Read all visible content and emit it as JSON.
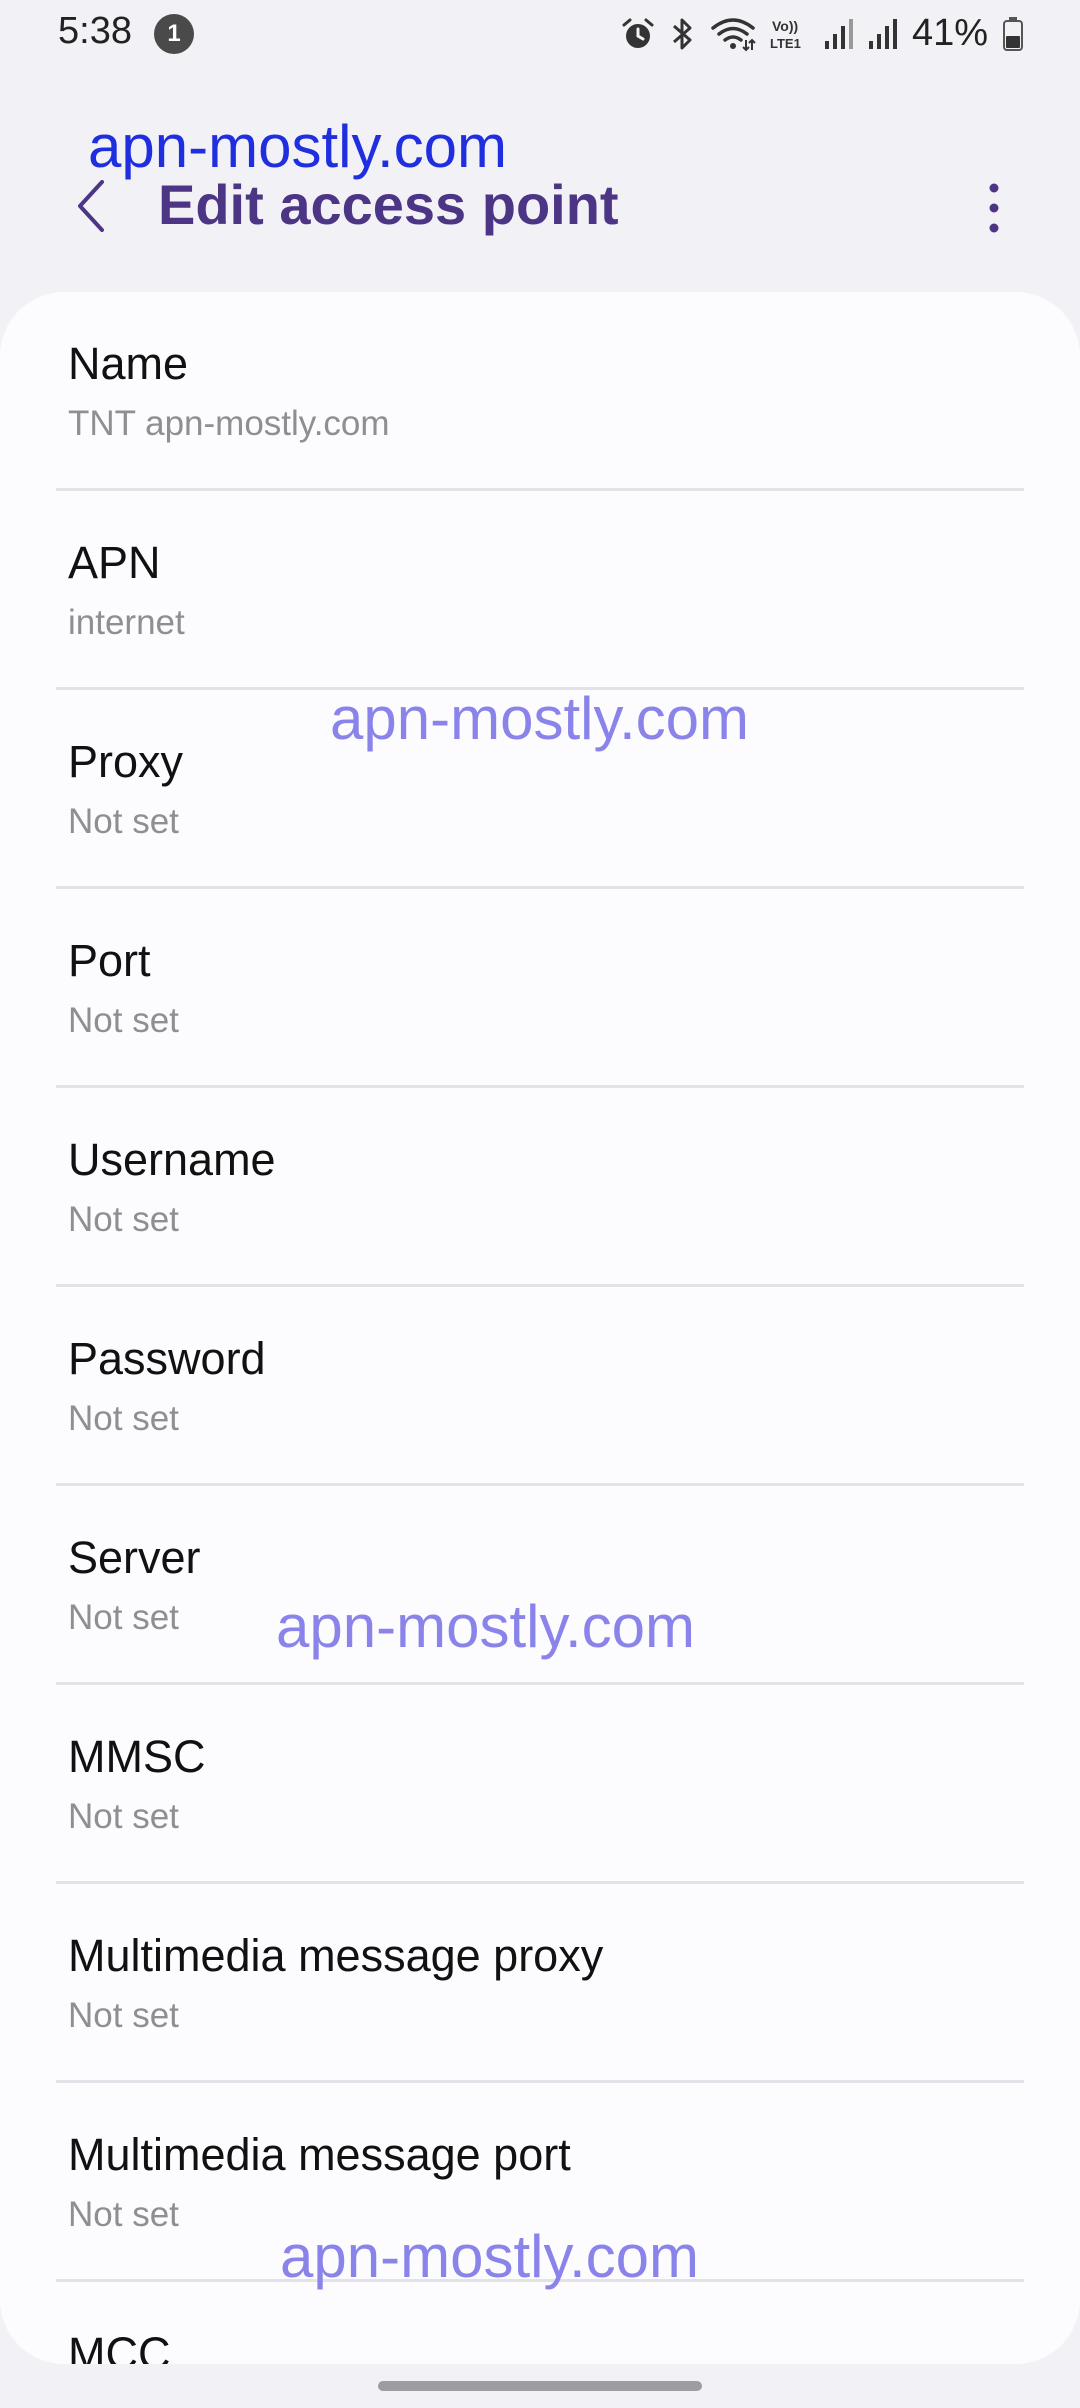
{
  "status_bar": {
    "time": "5:38",
    "notification_count": "1",
    "battery_percent": "41%",
    "icons": [
      "alarm-icon",
      "bluetooth-icon",
      "wifi-icon",
      "volte-icon",
      "signal-icon",
      "signal-icon",
      "battery-icon"
    ],
    "volte_top": "Vo))",
    "volte_bottom": "LTE1"
  },
  "watermark": "apn-mostly.com",
  "header": {
    "title": "Edit access point",
    "back_icon": "chevron-left-icon",
    "more_icon": "more-vertical-icon"
  },
  "settings": [
    {
      "label": "Name",
      "value": "TNT apn-mostly.com"
    },
    {
      "label": "APN",
      "value": "internet"
    },
    {
      "label": "Proxy",
      "value": "Not set"
    },
    {
      "label": "Port",
      "value": "Not set"
    },
    {
      "label": "Username",
      "value": "Not set"
    },
    {
      "label": "Password",
      "value": "Not set"
    },
    {
      "label": "Server",
      "value": "Not set"
    },
    {
      "label": "MMSC",
      "value": "Not set"
    },
    {
      "label": "Multimedia message proxy",
      "value": "Not set"
    },
    {
      "label": "Multimedia message port",
      "value": "Not set"
    },
    {
      "label": "MCC",
      "value": ""
    }
  ],
  "colors": {
    "title": "#4d3585",
    "background": "#f2f1f6",
    "card": "#fcfcfe",
    "watermark_primary": "#1f2fe0",
    "watermark_secondary": "#8a84ea"
  }
}
